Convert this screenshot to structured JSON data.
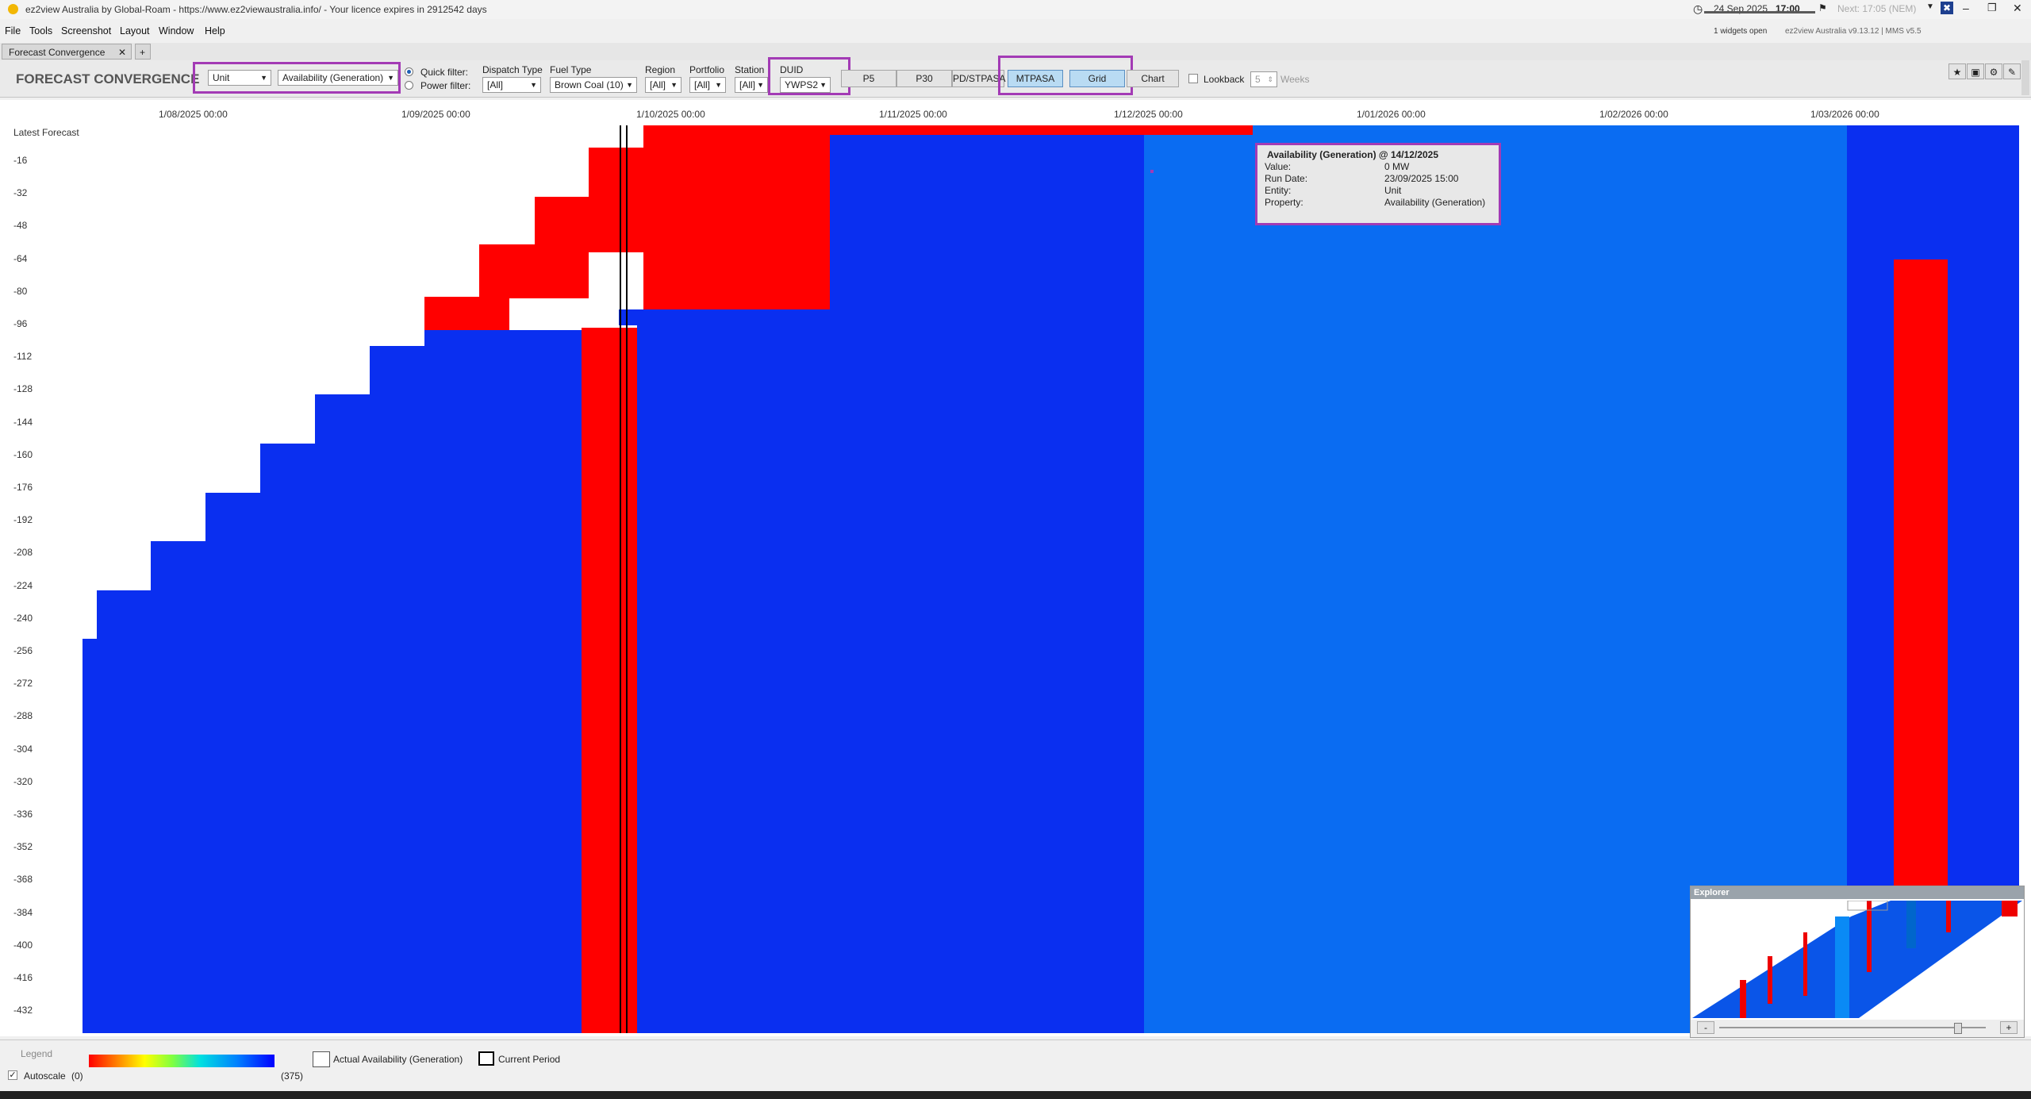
{
  "window": {
    "title": "ez2view Australia by Global-Roam - https://www.ez2viewaustralia.info/ - Your licence expires in 2912542 days",
    "date": "24 Sep 2025",
    "time": "17:00",
    "next": "Next: 17:05 (NEM)",
    "widgets_open": "1 widgets open",
    "version": "ez2view Australia v9.13.12 | MMS v5.5"
  },
  "menu": [
    "File",
    "Tools",
    "Screenshot",
    "Layout",
    "Window",
    "Help"
  ],
  "tabs": [
    {
      "label": "Forecast Convergence"
    }
  ],
  "toolbar": {
    "widget_title": "FORECAST CONVERGENCE",
    "entity": "Unit",
    "property": "Availability (Generation)",
    "quick_filter": "Quick filter:",
    "power_filter": "Power filter:",
    "dispatch_type_label": "Dispatch Type",
    "dispatch_type_value": "[All]",
    "fuel_type_label": "Fuel Type",
    "fuel_type_value": "Brown Coal (10)",
    "region_label": "Region",
    "region_value": "[All]",
    "portfolio_label": "Portfolio",
    "portfolio_value": "[All]",
    "station_label": "Station",
    "station_value": "[All]",
    "duid_label": "DUID",
    "duid_value": "YWPS2",
    "buttons": [
      "P5",
      "P30",
      "PD/STPASA",
      "MTPASA",
      "Grid",
      "Chart"
    ],
    "lookback_label": "Lookback",
    "lookback_value": "5",
    "weeks_label": "Weeks"
  },
  "chart": {
    "top_label": "Latest Forecast",
    "y_ticks": [
      "-16",
      "-32",
      "-48",
      "-64",
      "-80",
      "-96",
      "-112",
      "-128",
      "-144",
      "-160",
      "-176",
      "-192",
      "-208",
      "-224",
      "-240",
      "-256",
      "-272",
      "-288",
      "-304",
      "-320",
      "-336",
      "-352",
      "-368",
      "-384",
      "-400",
      "-416",
      "-432"
    ],
    "x_ticks": [
      "1/08/2025 00:00",
      "1/09/2025 00:00",
      "1/10/2025 00:00",
      "1/11/2025 00:00",
      "1/12/2025 00:00",
      "1/01/2026 00:00",
      "1/02/2026 00:00",
      "1/03/2026 00:00"
    ],
    "colors": {
      "zero": "#ff0000",
      "full": "#0000ff",
      "mid_blue": "#0a2ff0",
      "light_blue": "#0a6cf2"
    }
  },
  "tooltip": {
    "title": "Availability (Generation) @ 14/12/2025",
    "rows": [
      {
        "k": "Value:",
        "v": "0 MW"
      },
      {
        "k": "Run Date:",
        "v": "23/09/2025 15:00"
      },
      {
        "k": "Entity:",
        "v": "Unit"
      },
      {
        "k": "Property:",
        "v": "Availability (Generation)"
      }
    ]
  },
  "explorer": {
    "title": "Explorer",
    "minus": "-",
    "plus": "+"
  },
  "legend": {
    "title": "Legend",
    "autoscale": "Autoscale",
    "min": "(0)",
    "max": "(375)",
    "actual": "Actual Availability (Generation)",
    "current_period": "Current Period"
  }
}
